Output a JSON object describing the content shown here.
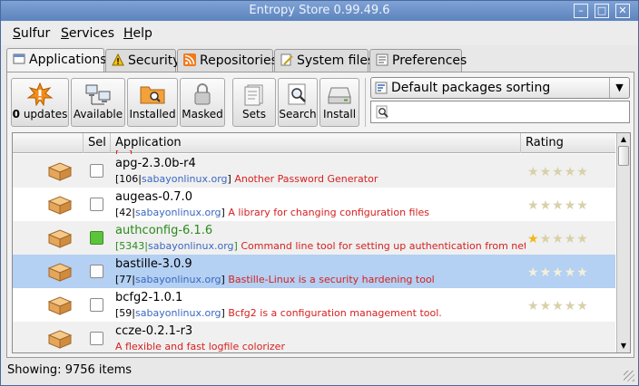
{
  "window": {
    "title": "Entropy Store 0.99.49.6",
    "min_label": "–",
    "max_label": "□",
    "close_label": "✕"
  },
  "menu": [
    {
      "accel": "S",
      "rest": "ulfur"
    },
    {
      "accel": "S",
      "rest": "ervices"
    },
    {
      "accel": "H",
      "rest": "elp"
    }
  ],
  "tabs": [
    {
      "label": "Applications",
      "icon": "applications-icon",
      "active": true
    },
    {
      "label": "Security",
      "icon": "warning-icon"
    },
    {
      "label": "Repositories",
      "icon": "rss-icon"
    },
    {
      "label": "System files",
      "icon": "edit-icon"
    },
    {
      "label": "Preferences",
      "icon": "preferences-icon"
    }
  ],
  "toolbar": {
    "updates_count": "0",
    "updates_label": "updates",
    "available_label": "Available",
    "installed_label": "Installed",
    "masked_label": "Masked",
    "sets_label": "Sets",
    "search_label": "Search",
    "install_label": "Install"
  },
  "sort": {
    "selected": "Default packages sorting"
  },
  "search": {
    "value": ""
  },
  "list": {
    "headers": {
      "sel": "Sel",
      "application": "Application",
      "rating": "Rating"
    },
    "partial_top": "[...] ... ... ... ...",
    "rows": [
      {
        "name": "apg-2.3.0b-r4",
        "count": "106",
        "repo": "sabayonlinux.org",
        "desc": "Another Password Generator",
        "checked": false,
        "installed": false,
        "rating": 0
      },
      {
        "name": "augeas-0.7.0",
        "count": "42",
        "repo": "sabayonlinux.org",
        "desc": "A library for changing configuration files",
        "checked": false,
        "installed": false,
        "rating": 0
      },
      {
        "name": "authconfig-6.1.6",
        "count": "5343",
        "repo": "sabayonlinux.org",
        "desc": "Command line tool for setting up authentication from network services",
        "checked": true,
        "installed": true,
        "rating": 1
      },
      {
        "name": "bastille-3.0.9",
        "count": "77",
        "repo": "sabayonlinux.org",
        "desc": "Bastille-Linux is a security hardening tool",
        "checked": false,
        "installed": false,
        "rating": 0,
        "selected": true
      },
      {
        "name": "bcfg2-1.0.1",
        "count": "59",
        "repo": "sabayonlinux.org",
        "desc": "Bcfg2 is a configuration management tool.",
        "checked": false,
        "installed": false,
        "rating": 0
      },
      {
        "name": "ccze-0.2.1-r3",
        "count": "",
        "repo": "",
        "desc": "A flexible and fast logfile colorizer",
        "checked": false,
        "installed": false,
        "rating": 0
      }
    ]
  },
  "status": {
    "text": "Showing: 9756 items"
  },
  "colors": {
    "installed": "#2a8a1a",
    "repo": "#3a67c2",
    "desc": "#d62020",
    "selected_row": "#b4d0f2",
    "star_on": "#f2b712"
  }
}
